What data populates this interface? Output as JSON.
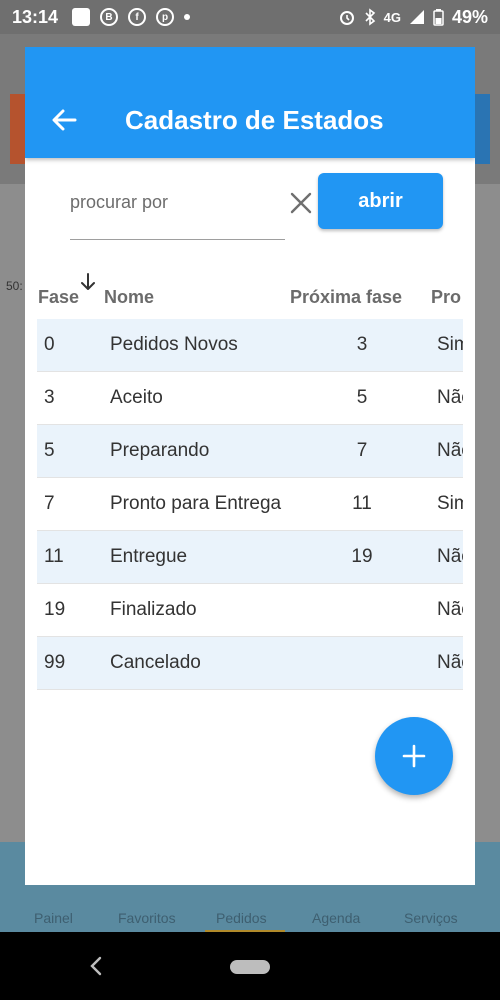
{
  "status_bar": {
    "time": "13:14",
    "network": "4G",
    "battery": "49%",
    "icons": [
      "image-icon",
      "b-icon",
      "facebook-icon",
      "pinterest-icon",
      "dot-icon",
      "alarm-icon",
      "bluetooth-icon",
      "signal-icon",
      "battery-icon"
    ]
  },
  "background_nav": {
    "items": [
      "Painel",
      "Favoritos",
      "Pedidos",
      "Agenda",
      "Serviços"
    ]
  },
  "background_left_text": "50:",
  "dialog": {
    "title": "Cadastro de Estados",
    "search_placeholder": "procurar por",
    "open_label": "abrir"
  },
  "table": {
    "headers": [
      "Fase",
      "Nome",
      "Próxima fase",
      "Pro"
    ],
    "rows": [
      [
        "0",
        "Pedidos Novos",
        "3",
        "Sim"
      ],
      [
        "3",
        "Aceito",
        "5",
        "Não"
      ],
      [
        "5",
        "Preparando",
        "7",
        "Não"
      ],
      [
        "7",
        "Pronto para Entrega",
        "11",
        "Sim"
      ],
      [
        "11",
        "Entregue",
        "19",
        "Não"
      ],
      [
        "19",
        "Finalizado",
        "",
        "Não"
      ],
      [
        "99",
        "Cancelado",
        "",
        "Não"
      ]
    ]
  },
  "colors": {
    "primary": "#2196f3",
    "row_alt": "#eaf3fb"
  }
}
